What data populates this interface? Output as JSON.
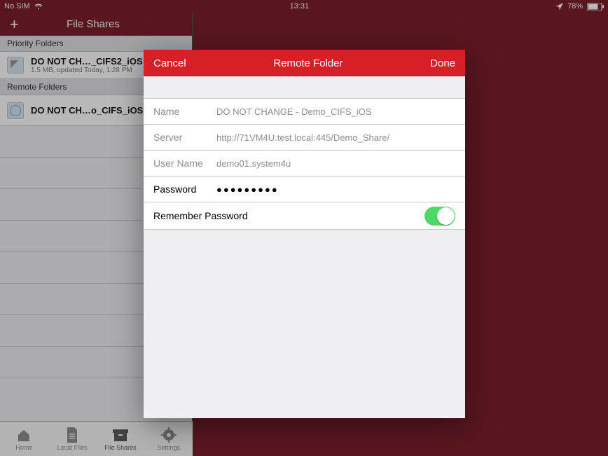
{
  "statusbar": {
    "carrier": "No SIM",
    "time": "13:31",
    "battery": "78%"
  },
  "sidebar": {
    "add_label": "+",
    "title": "File Shares",
    "sections": [
      {
        "header": "Priority Folders",
        "items": [
          {
            "title": "DO NOT CH…_CIFS2_iOS",
            "subtitle": "1.5 MB, updated Today, 1:28 PM",
            "icon": "thunder"
          }
        ]
      },
      {
        "header": "Remote Folders",
        "items": [
          {
            "title": "DO NOT CH…o_CIFS_iOS",
            "subtitle": "",
            "icon": "globe"
          }
        ]
      }
    ]
  },
  "tabs": [
    {
      "label": "Home",
      "icon": "home"
    },
    {
      "label": "Local Files",
      "icon": "file"
    },
    {
      "label": "File Shares",
      "icon": "box",
      "selected": true
    },
    {
      "label": "Settings",
      "icon": "gear"
    }
  ],
  "modal": {
    "cancel": "Cancel",
    "title": "Remote Folder",
    "done": "Done",
    "fields": {
      "name": {
        "label": "Name",
        "value": "DO NOT CHANGE - Demo_CIFS_iOS",
        "editable": false
      },
      "server": {
        "label": "Server",
        "value": "http://71VM4U.test.local:445/Demo_Share/",
        "editable": false
      },
      "user": {
        "label": "User Name",
        "value": "demo01.system4u",
        "editable": false
      },
      "password": {
        "label": "Password",
        "value": "●●●●●●●●●",
        "editable": true
      },
      "remember": {
        "label": "Remember Password",
        "value": true
      }
    }
  }
}
